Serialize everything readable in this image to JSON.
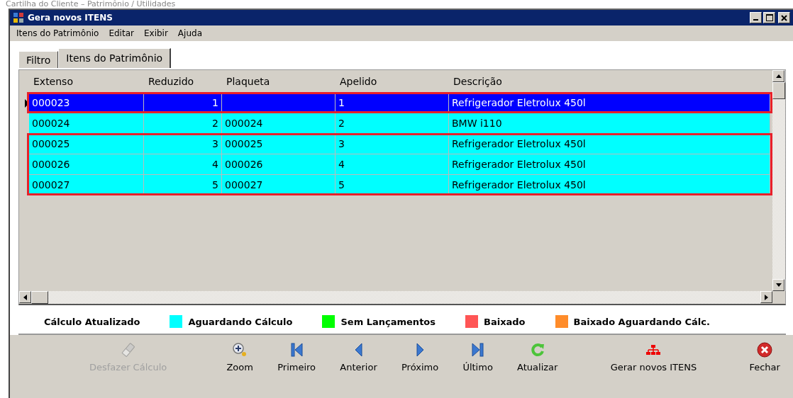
{
  "page_header": "Cartilha do Cliente – Patrimônio / Utilidades",
  "window": {
    "title": "Gera novos ITENS"
  },
  "menu": [
    "Itens do Patrimônio",
    "Editar",
    "Exibir",
    "Ajuda"
  ],
  "tabs": [
    {
      "label": "Filtro",
      "selected": false
    },
    {
      "label": "Itens do Patrimônio",
      "selected": true
    }
  ],
  "table": {
    "columns": [
      {
        "label": "Extenso"
      },
      {
        "label": "Reduzido"
      },
      {
        "label": "Plaqueta"
      },
      {
        "label": "Apelido"
      },
      {
        "label": "Descrição"
      }
    ],
    "rows": [
      {
        "cells": [
          "000023",
          "1",
          "",
          "1",
          "Refrigerador Eletrolux 450l"
        ],
        "selected": true,
        "marked": true
      },
      {
        "cells": [
          "000024",
          "2",
          "000024",
          "2",
          "BMW i110"
        ],
        "selected": false,
        "marked": false,
        "color": "#00ffff"
      },
      {
        "cells": [
          "000025",
          "3",
          "000025",
          "3",
          "Refrigerador Eletrolux 450l"
        ],
        "selected": false,
        "marked": true,
        "color": "#00ffff"
      },
      {
        "cells": [
          "000026",
          "4",
          "000026",
          "4",
          "Refrigerador Eletrolux 450l"
        ],
        "selected": false,
        "marked": true,
        "color": "#00ffff"
      },
      {
        "cells": [
          "000027",
          "5",
          "000027",
          "5",
          "Refrigerador Eletrolux 450l"
        ],
        "selected": false,
        "marked": true,
        "color": "#00ffff"
      }
    ]
  },
  "legend": [
    {
      "label": "Cálculo Atualizado"
    },
    {
      "label": "Aguardando Cálculo",
      "color": "#00ffff"
    },
    {
      "label": "Sem Lançamentos",
      "color": "#00ff00"
    },
    {
      "label": "Baixado",
      "color": "#ff5555"
    },
    {
      "label": "Baixado Aguardando Cálc.",
      "color": "#ff8c2a"
    }
  ],
  "toolbar": [
    {
      "label": "Desfazer Cálculo",
      "kind": "eraser",
      "disabled": true
    },
    {
      "label": "Zoom",
      "kind": "zoom",
      "disabled": false
    },
    {
      "label": "Primeiro",
      "kind": "first",
      "disabled": false
    },
    {
      "label": "Anterior",
      "kind": "prev",
      "disabled": false
    },
    {
      "label": "Próximo",
      "kind": "next",
      "disabled": false
    },
    {
      "label": "Último",
      "kind": "last",
      "disabled": false
    },
    {
      "label": "Atualizar",
      "kind": "refresh",
      "disabled": false
    },
    {
      "label": "Gerar novos ITENS",
      "kind": "tree",
      "disabled": false
    },
    {
      "label": "Fechar",
      "kind": "close",
      "disabled": false
    }
  ]
}
